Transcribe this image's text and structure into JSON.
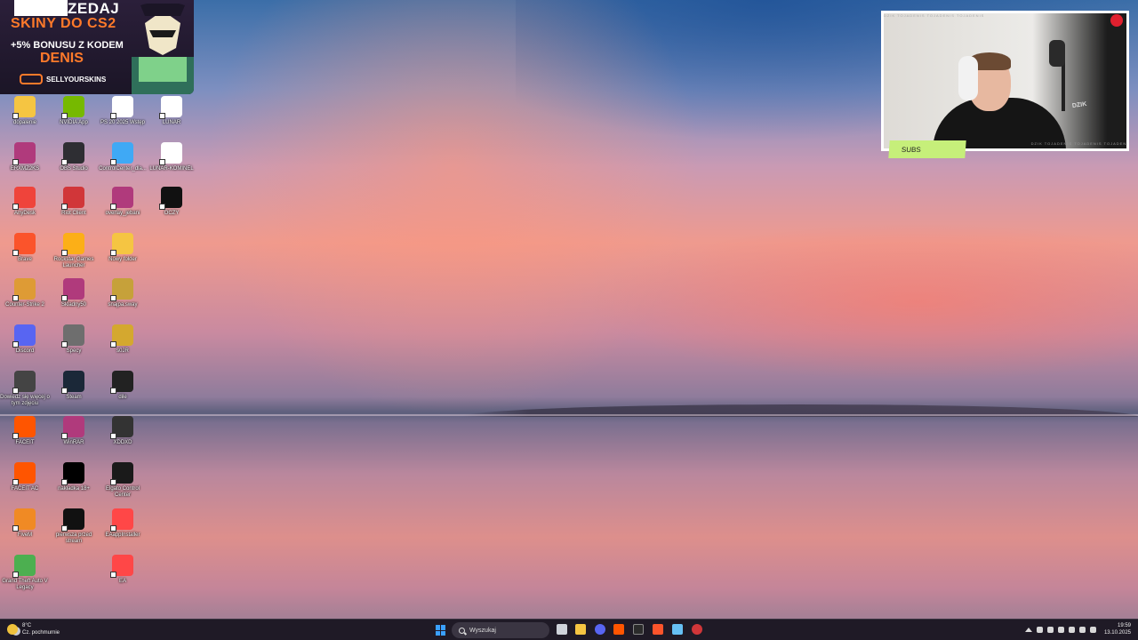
{
  "ad": {
    "line1": "ZEDAJ",
    "line2": "SKINY DO CS2",
    "line3": "+5% BONUSU Z KODEM",
    "line4": "DENIS",
    "brand": "SELLYOURSKINS"
  },
  "desktop": {
    "icons": [
      {
        "label": "dopalenie",
        "color": "#f5c542"
      },
      {
        "label": "NVIDIA App",
        "color": "#76b900"
      },
      {
        "label": "PS 20 2025 Wstęp",
        "color": "#ffffff"
      },
      {
        "label": "LUNAR",
        "color": "#ffffff"
      },
      {
        "label": "ERXMZ2KS",
        "color": "#b03a7c"
      },
      {
        "label": "OBS Studio",
        "color": "#2e2e33"
      },
      {
        "label": "ControlCenter_dla...",
        "color": "#3fa9f5"
      },
      {
        "label": "LUNAR-KOMINEL",
        "color": "#ffffff"
      },
      {
        "label": "AnyDesk",
        "color": "#ef443b"
      },
      {
        "label": "Riot Client",
        "color": "#d13639"
      },
      {
        "label": "overlay_jebani",
        "color": "#b03a7c"
      },
      {
        "label": "OCZY",
        "color": "#111111"
      },
      {
        "label": "Brave",
        "color": "#fb542b"
      },
      {
        "label": "Rockstar Games Launcher",
        "color": "#fcaf17"
      },
      {
        "label": "Nowy folder",
        "color": "#f5c542"
      },
      {
        "label": "Counter-Strike 2",
        "color": "#de9b35"
      },
      {
        "label": "Skladny50",
        "color": "#b03a7c"
      },
      {
        "label": "snajpa.sway",
        "color": "#c6a13a"
      },
      {
        "label": "Discord",
        "color": "#5865f2"
      },
      {
        "label": "Specy",
        "color": "#6e6e6e"
      },
      {
        "label": "s0JR",
        "color": "#d4a82f"
      },
      {
        "label": "Dowiedz się więcej o tym zdjęciu",
        "color": "#444444"
      },
      {
        "label": "Steam",
        "color": "#1b2838"
      },
      {
        "label": "dile",
        "color": "#222222"
      },
      {
        "label": "FACEIT",
        "color": "#ff5500"
      },
      {
        "label": "WinRAR",
        "color": "#b03a7c"
      },
      {
        "label": "XDDXD",
        "color": "#333333"
      },
      {
        "label": "FACEIT AC",
        "color": "#ff5500"
      },
      {
        "label": "nakładka 18+",
        "color": "#000000"
      },
      {
        "label": "Elgato Control Center",
        "color": "#1a1a1a"
      },
      {
        "label": "FiveM",
        "color": "#f08a24"
      },
      {
        "label": "pierwsza przed stream",
        "color": "#111111"
      },
      {
        "label": "EAappInstaller",
        "color": "#ff4747"
      },
      {
        "label": "Grand Theft Auto V Legacy",
        "color": "#4caf50"
      },
      {
        "label": "EA",
        "color": "#ff4747"
      }
    ]
  },
  "webcam": {
    "subs_label": "SUBS",
    "band_text": "DZIK TOJADENIS TOJADENIS TOJADENIS",
    "shirt_text": "DZIK"
  },
  "taskbar": {
    "weather_temp": "8°C",
    "weather_desc": "Cz. pochmurnie",
    "search_placeholder": "Wyszukaj",
    "time": "19:59",
    "date": "13.10.2025"
  }
}
